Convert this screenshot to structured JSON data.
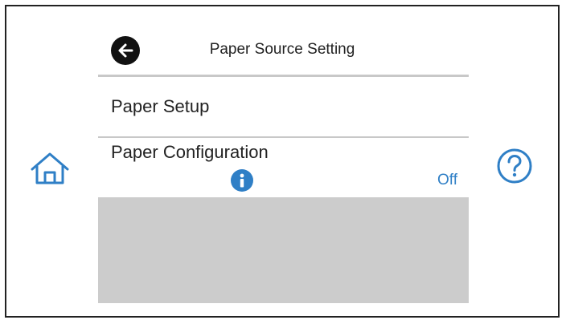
{
  "header": {
    "title": "Paper Source Setting",
    "back_icon": "arrow-left-circle-icon"
  },
  "menu": {
    "items": [
      {
        "label": "Paper Setup"
      },
      {
        "label": "Paper Configuration",
        "value": "Off",
        "info_icon": "info-circle-icon"
      }
    ]
  },
  "nav": {
    "home_icon": "home-icon",
    "help_icon": "question-circle-icon"
  },
  "colors": {
    "accent": "#2f7fc6",
    "divider": "#c8c8c8",
    "panel": "#cccccc",
    "text": "#222222"
  }
}
